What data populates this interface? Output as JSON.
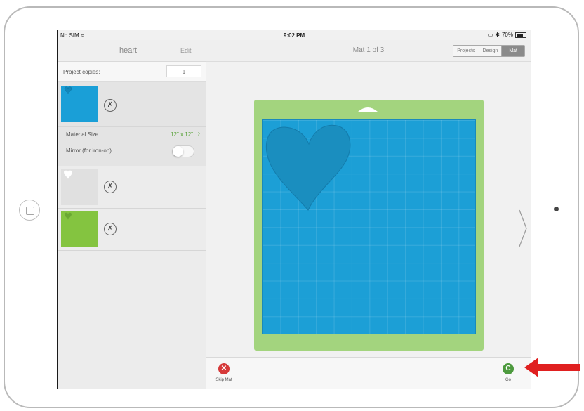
{
  "status_bar": {
    "carrier": "No SIM",
    "wifi_icon": "wifi-icon",
    "time": "9:02 PM",
    "battery": "70%",
    "battery_level": 0.7
  },
  "sidebar": {
    "title": "heart",
    "edit_label": "Edit",
    "copies_label": "Project copies:",
    "copies_value": "1",
    "mats": [
      {
        "color": "#1a9fd7",
        "icon": "scissors-icon"
      },
      {
        "color": "#e0e0e0",
        "icon": "scissors-icon"
      },
      {
        "color": "#84c440",
        "icon": "scissors-icon"
      }
    ],
    "material_size_label": "Material Size",
    "material_size_value": "12\" x 12\"",
    "mirror_label": "Mirror (for iron-on)",
    "mirror_on": false
  },
  "header": {
    "title": "Mat 1 of 3",
    "tabs": [
      "Projects",
      "Design",
      "Mat"
    ],
    "active_tab": "Mat"
  },
  "canvas": {
    "mat_color": "#a3d47e",
    "material_color": "#1c9fd6",
    "shape": "heart-shape"
  },
  "footer": {
    "skip_label": "Skip Mat",
    "go_label": "Go",
    "go_icon_text": "C",
    "skip_color": "#d63a3a",
    "go_color": "#4d9a3e"
  },
  "annotation": {
    "arrow_color": "#e02020"
  }
}
